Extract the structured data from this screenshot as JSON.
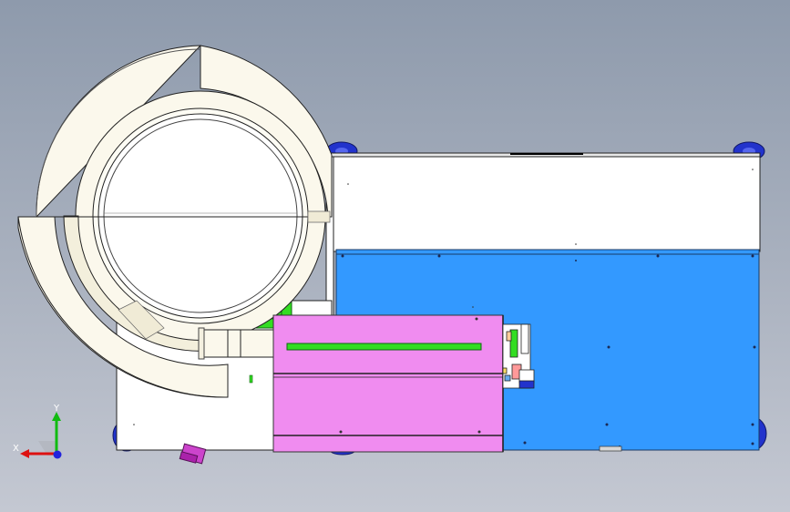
{
  "viewport": {
    "triad": {
      "x_label": "X",
      "y_label": "Y"
    },
    "colors": {
      "background_top": "#8e9aac",
      "background_bottom": "#c4c8d2",
      "part_white": "#ffffff",
      "part_cream": "#fbf8ec",
      "panel_blue": "#3399ff",
      "cover_pink": "#f08cf0",
      "bracket_green": "#33dd22",
      "wheel_blue": "#2233cc",
      "axis_x": "#dd1111",
      "axis_y": "#11bb11",
      "axis_origin": "#2222dd"
    }
  }
}
